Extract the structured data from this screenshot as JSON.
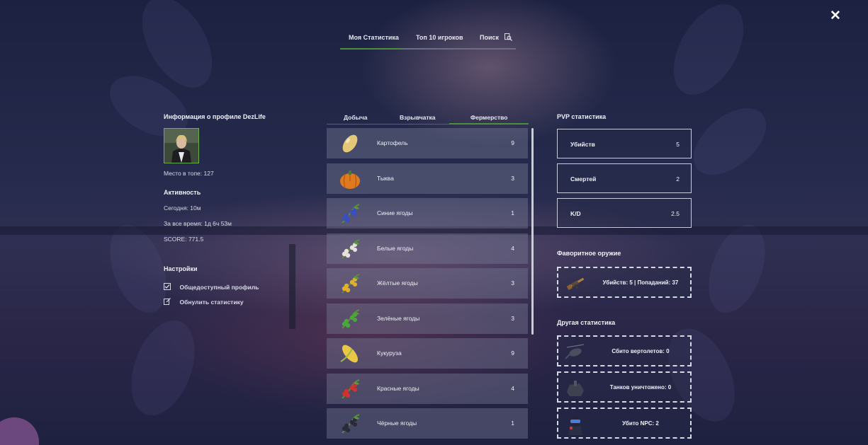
{
  "top_tabs": [
    {
      "label": "Моя Статистика"
    },
    {
      "label": "Топ 10 игроков"
    },
    {
      "label": "Поиск"
    }
  ],
  "profile": {
    "title": "Информация о профиле DezLife",
    "rank": "Место в топе: 127",
    "activity_title": "Активность",
    "today": "Сегодня: 10м",
    "all_time": "За все время: 1д 6ч 53м",
    "score": "SCORE: 771.5",
    "settings_title": "Настройки",
    "public_profile": "Общедоступный профиль",
    "reset_stats": "Обнулить статистику"
  },
  "mid_tabs": [
    {
      "label": "Добыча"
    },
    {
      "label": "Взрывчатка"
    },
    {
      "label": "Фермерство"
    }
  ],
  "farming": [
    {
      "name": "Картофель",
      "value": "9",
      "icon": "potato-icon",
      "color": "#e3c878"
    },
    {
      "name": "Тыква",
      "value": "3",
      "icon": "pumpkin-icon",
      "color": "#e07a1e"
    },
    {
      "name": "Синие ягоды",
      "value": "1",
      "icon": "berry-icon",
      "color": "#3a4ec0"
    },
    {
      "name": "Белые ягоды",
      "value": "4",
      "icon": "berry-icon",
      "color": "#e8e2dc"
    },
    {
      "name": "Жёлтые ягоды",
      "value": "3",
      "icon": "berry-icon",
      "color": "#e0b028"
    },
    {
      "name": "Зелёные ягоды",
      "value": "3",
      "icon": "berry-icon",
      "color": "#48a83a"
    },
    {
      "name": "Кукуруза",
      "value": "9",
      "icon": "corn-icon",
      "color": "#e8c845"
    },
    {
      "name": "Красные ягоды",
      "value": "4",
      "icon": "berry-icon",
      "color": "#d03030"
    },
    {
      "name": "Чёрные ягоды",
      "value": "1",
      "icon": "berry-icon",
      "color": "#2a2a3a"
    }
  ],
  "pvp": {
    "title": "PVP статистика",
    "kills_label": "Убийств",
    "kills": "5",
    "deaths_label": "Смертей",
    "deaths": "2",
    "kd_label": "K/D",
    "kd": "2.5"
  },
  "favorite": {
    "title": "Фаворитное оружие",
    "text": "Убийств: 5 | Попаданий: 37"
  },
  "other": {
    "title": "Другая статистика",
    "helis": "Сбито вертолетов: 0",
    "tanks": "Танков уничтожено: 0",
    "npc": "Убито NPC: 2"
  },
  "colors": {
    "accent": "#4a8f3c"
  }
}
